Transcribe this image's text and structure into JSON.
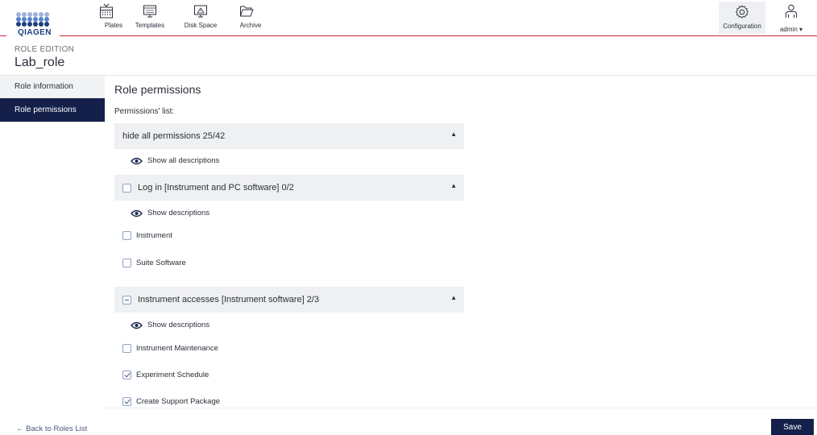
{
  "brand": {
    "logo_text": "QIAGEN",
    "accent": "#d6253b",
    "navy": "#14204a",
    "dot_colors": [
      "#9fb3dc",
      "#5a84c8",
      "#1d3f7a"
    ]
  },
  "nav": {
    "plates": {
      "label": "Plates",
      "icon": "plates-icon"
    },
    "templates": {
      "label": "Templates",
      "icon": "templates-icon"
    },
    "disk_space": {
      "label": "Disk Space",
      "icon": "disk-space-icon"
    },
    "archive": {
      "label": "Archive",
      "icon": "archive-folder-icon"
    },
    "configuration": {
      "label": "Configuration",
      "icon": "gear-icon"
    },
    "admin": {
      "label": "admin ▾",
      "icon": "user-icon"
    }
  },
  "header": {
    "section": "ROLE EDITION",
    "role_name": "Lab_role"
  },
  "sidebar": {
    "items": [
      {
        "label": "Role information",
        "active": false
      },
      {
        "label": "Role permissions",
        "active": true
      }
    ]
  },
  "main": {
    "title": "Role permissions",
    "list_label": "Permissions' list:",
    "hide_all": "hide all permissions 25/42",
    "show_all_descriptions": "Show all descriptions",
    "groups": [
      {
        "label": "Log in [Instrument and PC software] 0/2",
        "state": "unchecked",
        "show_descriptions": "Show descriptions",
        "items": [
          {
            "label": "Instrument",
            "checked": false
          },
          {
            "label": "Suite Software",
            "checked": false
          }
        ]
      },
      {
        "label": "Instrument accesses [Instrument software] 2/3",
        "state": "indeterminate",
        "show_descriptions": "Show descriptions",
        "items": [
          {
            "label": "Instrument Maintenance",
            "checked": false
          },
          {
            "label": "Experiment Schedule",
            "checked": true
          },
          {
            "label": "Create Support Package",
            "checked": true
          }
        ]
      }
    ]
  },
  "footer": {
    "back_label": "← Back to Roles List",
    "save_label": "Save"
  },
  "caret_symbol": "▲"
}
